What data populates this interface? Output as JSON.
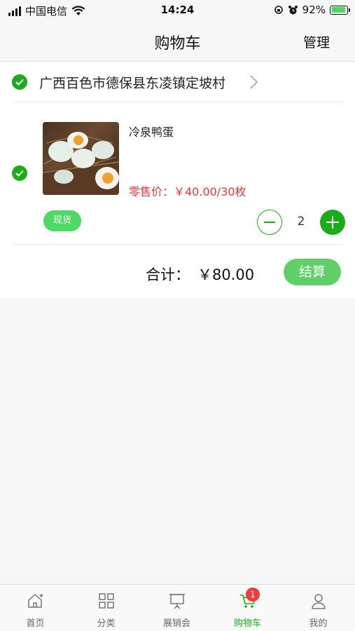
{
  "status_bar": {
    "carrier": "中国电信",
    "time": "14:24",
    "battery_percent": "92%",
    "battery_level": 0.92
  },
  "nav": {
    "title": "购物车",
    "manage_label": "管理"
  },
  "cart": {
    "address": "广西百色市德保县东凌镇定坡村",
    "address_selected": true,
    "items": [
      {
        "name": "冷泉鸭蛋",
        "price_text": "零售价：￥40.00/30枚",
        "badge": "现货",
        "quantity": "2",
        "selected": true
      }
    ],
    "total_label": "合计：",
    "total_value": "￥80.00",
    "checkout_label": "结算"
  },
  "tab_bar": {
    "items": [
      {
        "label": "首页",
        "icon": "home-icon"
      },
      {
        "label": "分类",
        "icon": "grid-icon"
      },
      {
        "label": "展销会",
        "icon": "exhibition-icon"
      },
      {
        "label": "购物车",
        "icon": "cart-icon",
        "active": true,
        "badge": "1"
      },
      {
        "label": "我的",
        "icon": "user-icon"
      }
    ]
  },
  "colors": {
    "accent_green": "#1aad19",
    "price_red": "#e4393c",
    "badge_red": "#f23c3c"
  }
}
